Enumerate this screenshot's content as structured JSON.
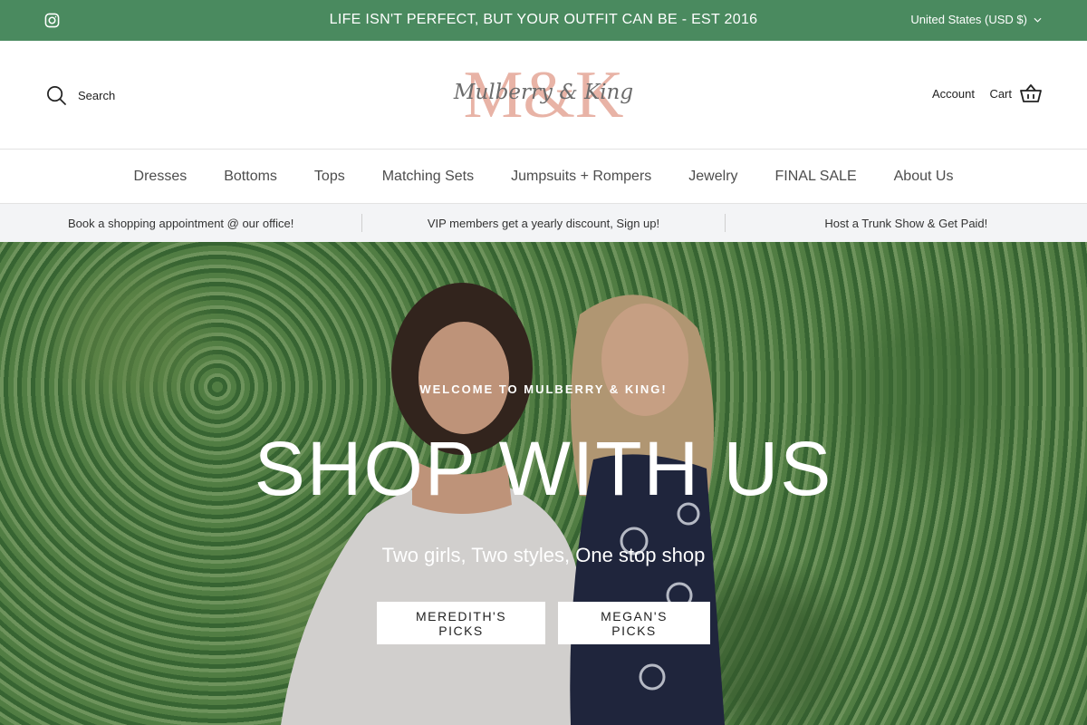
{
  "announcement": {
    "message": "LIFE ISN'T PERFECT, BUT YOUR OUTFIT CAN BE - EST 2016",
    "currency": "United States (USD $)"
  },
  "header": {
    "search_label": "Search",
    "account_label": "Account",
    "cart_label": "Cart",
    "logo": {
      "monogram": "M&K",
      "script": "Mulberry & King"
    }
  },
  "nav": {
    "items": [
      {
        "label": "Dresses"
      },
      {
        "label": "Bottoms"
      },
      {
        "label": "Tops"
      },
      {
        "label": "Matching Sets"
      },
      {
        "label": "Jumpsuits + Rompers"
      },
      {
        "label": "Jewelry"
      },
      {
        "label": "FINAL SALE"
      },
      {
        "label": "About Us"
      }
    ]
  },
  "promo": {
    "items": [
      {
        "label": "Book a shopping appointment @ our office!"
      },
      {
        "label": "VIP members get a yearly discount, Sign up!"
      },
      {
        "label": "Host a Trunk Show & Get Paid!"
      }
    ]
  },
  "hero": {
    "eyebrow": "WELCOME TO MULBERRY & KING!",
    "title": "SHOP WITH US",
    "subtitle": "Two girls, Two styles, One stop shop",
    "buttons": [
      {
        "label": "MEREDITH'S PICKS"
      },
      {
        "label": "MEGAN'S PICKS"
      }
    ]
  },
  "colors": {
    "announcement_bg": "#4a8a5f",
    "logo_pink": "#e8b3a6",
    "promo_bg": "#f3f4f6"
  },
  "icons": [
    "instagram-icon",
    "chevron-down-icon",
    "search-icon",
    "cart-basket-icon"
  ]
}
